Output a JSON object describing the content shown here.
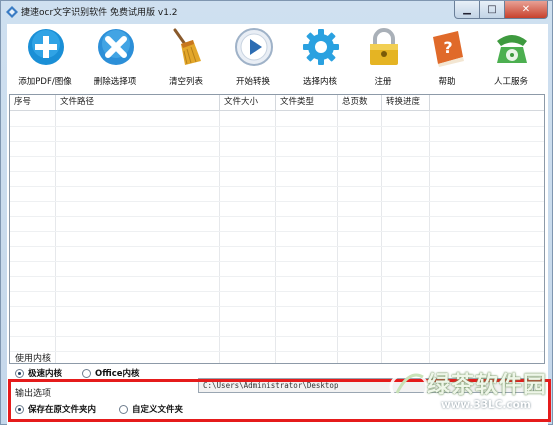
{
  "window": {
    "title": "捷速ocr文字识别软件 免费试用版 v1.2",
    "min_symbol": "▁",
    "max_symbol": "□",
    "close_symbol": "✕"
  },
  "toolbar": {
    "items": [
      {
        "label": "添加PDF/图像",
        "icon": "add-icon",
        "color": "#1a8fd6"
      },
      {
        "label": "删除选择项",
        "icon": "delete-icon",
        "color": "#2c8fd8"
      },
      {
        "label": "清空列表",
        "icon": "broom-icon",
        "color": "#e3a72a"
      },
      {
        "label": "开始转换",
        "icon": "play-icon",
        "color": "#2d6db3"
      },
      {
        "label": "选择内核",
        "icon": "gear-icon",
        "color": "#2aa1e0"
      },
      {
        "label": "注册",
        "icon": "lock-icon",
        "color": "#e5b423"
      },
      {
        "label": "帮助",
        "icon": "help-book-icon",
        "color": "#e06a2a"
      },
      {
        "label": "人工服务",
        "icon": "phone-icon",
        "color": "#3e9a3f"
      }
    ]
  },
  "table": {
    "columns": [
      "序号",
      "文件路径",
      "文件大小",
      "文件类型",
      "总页数",
      "转换进度"
    ],
    "rows": []
  },
  "engine": {
    "title": "使用内核",
    "options": [
      "极速内核",
      "Office内核"
    ],
    "selected": "极速内核"
  },
  "output": {
    "title": "输出选项",
    "options": [
      "保存在原文件夹内",
      "自定义文件夹"
    ],
    "selected": "保存在原文件夹内",
    "path": "C:\\Users\\Administrator\\Desktop"
  },
  "watermark": {
    "text": "绿茶软件园",
    "url": "www.33LC.com"
  }
}
